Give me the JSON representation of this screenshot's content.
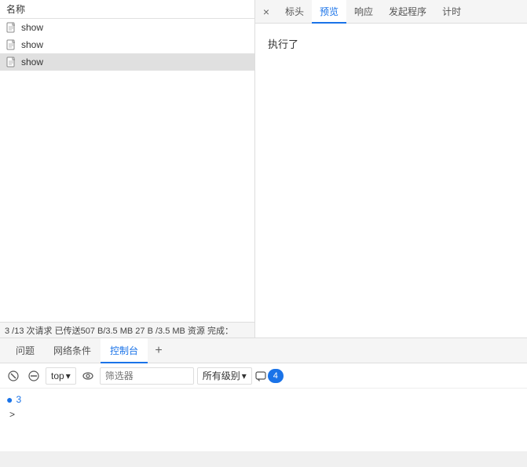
{
  "leftPanel": {
    "header": "名称",
    "items": [
      {
        "name": "show",
        "selected": false
      },
      {
        "name": "show",
        "selected": false
      },
      {
        "name": "show",
        "selected": true
      }
    ]
  },
  "statusBar": {
    "text": "3 /13 次请求  已传送507 B/3.5 MB  27 B /3.5 MB 资源 完成："
  },
  "rightPanel": {
    "tabs": [
      {
        "label": "标头",
        "active": false
      },
      {
        "label": "预览",
        "active": true
      },
      {
        "label": "响应",
        "active": false
      },
      {
        "label": "发起程序",
        "active": false
      },
      {
        "label": "计时",
        "active": false
      }
    ],
    "closeLabel": "×",
    "content": "执行了"
  },
  "consoleTabs": [
    {
      "label": "问题",
      "active": false
    },
    {
      "label": "网络条件",
      "active": false
    },
    {
      "label": "控制台",
      "active": true
    }
  ],
  "consoleToolbar": {
    "clearLabel": "🚫",
    "topLabel": "top",
    "dropdownArrow": "▾",
    "filterPlaceholder": "筛选器",
    "levelLabel": "所有级别",
    "badgeCount": "4",
    "eyeIcon": "👁"
  },
  "consoleBody": {
    "errorCount": "3",
    "arrowLabel": ">"
  }
}
